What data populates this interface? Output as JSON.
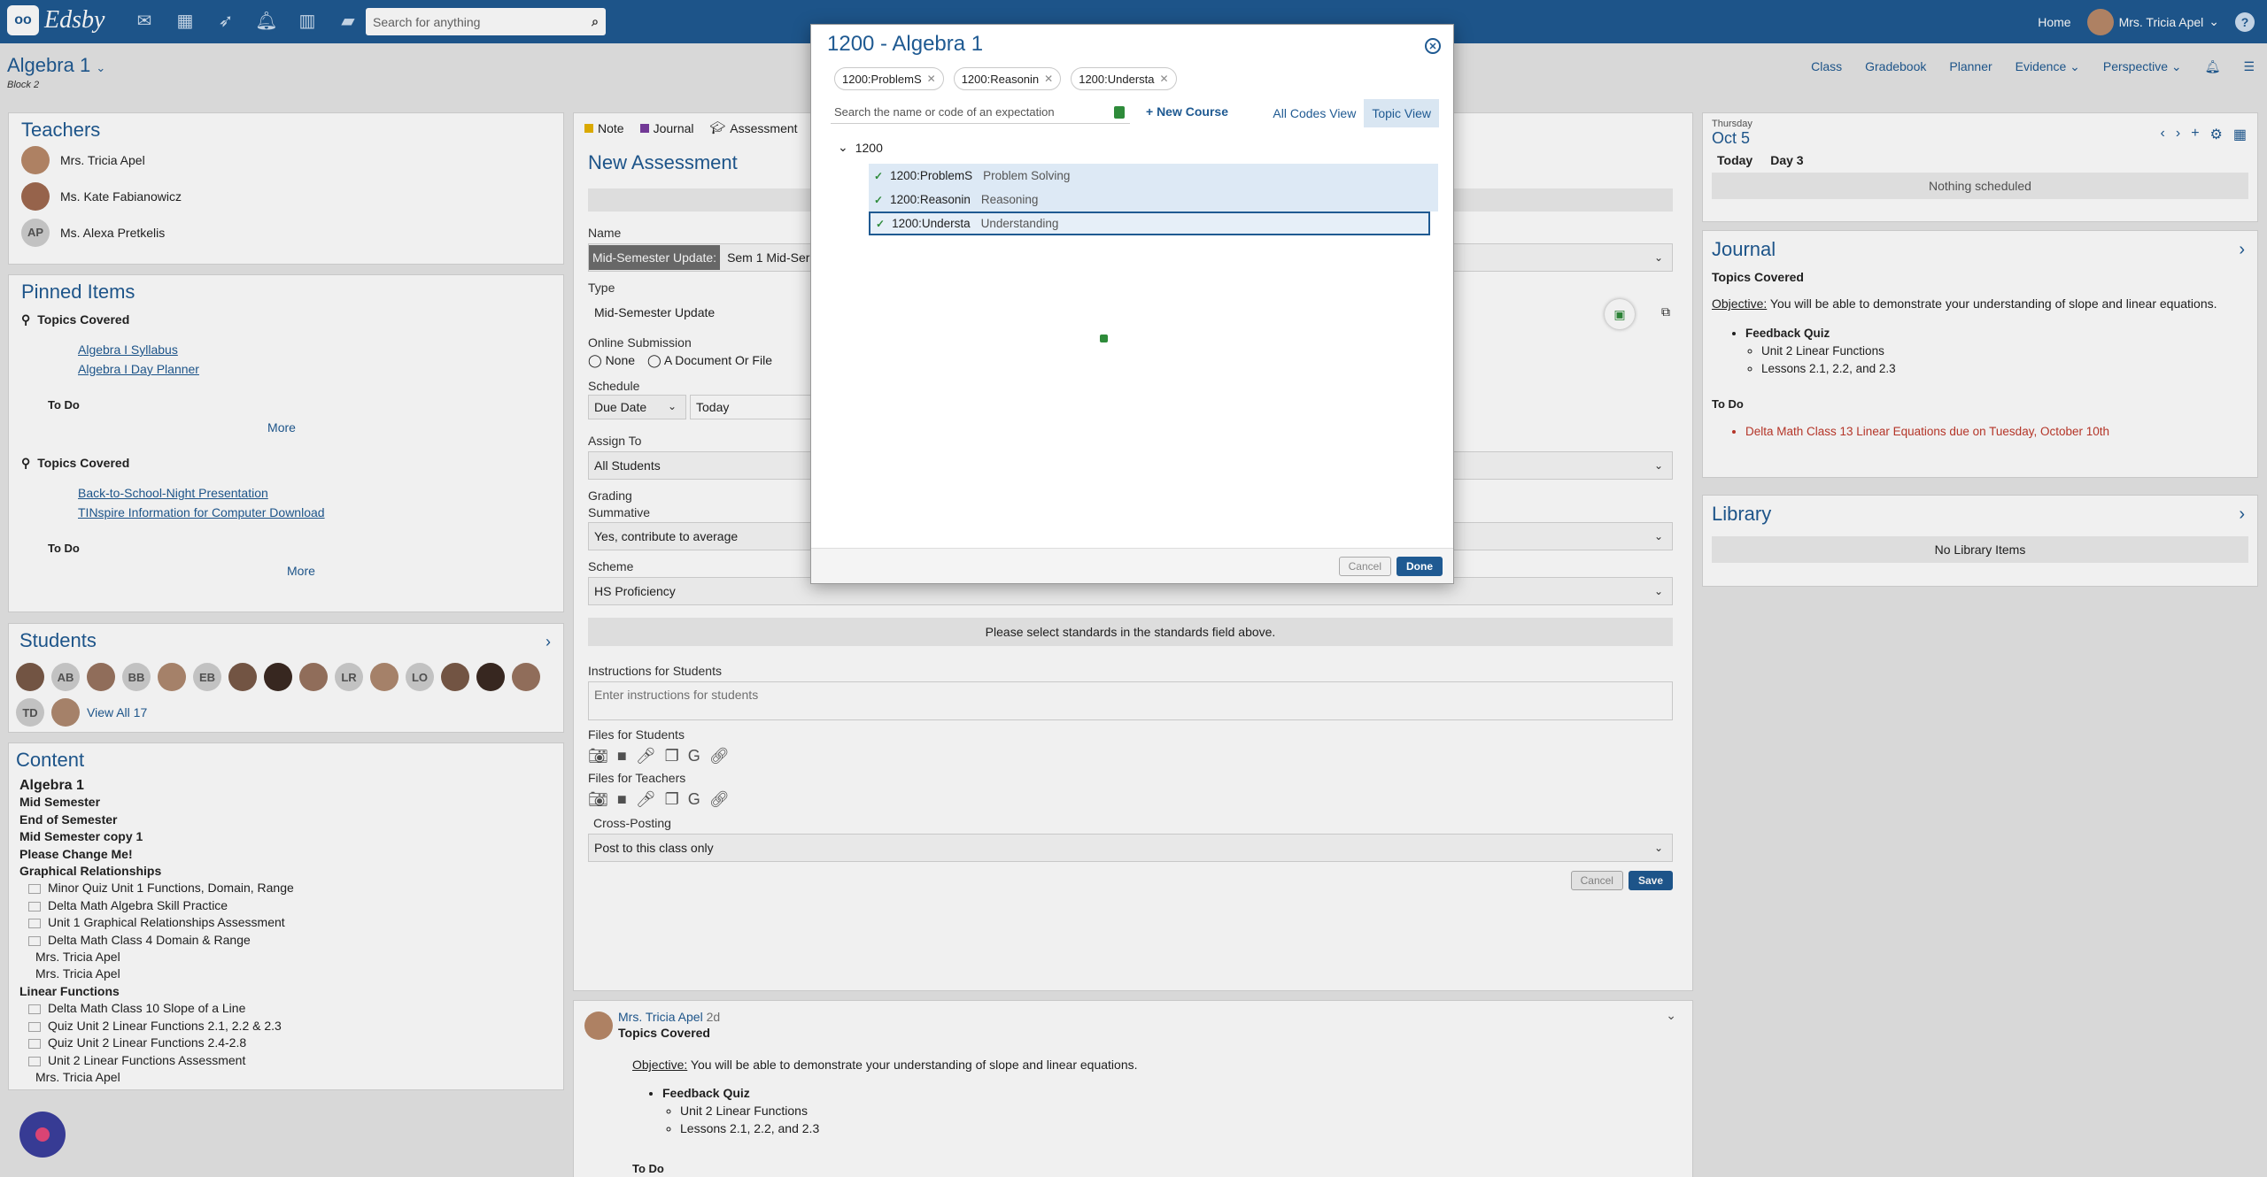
{
  "topbar": {
    "logo_text": "Edsby",
    "search_placeholder": "Search for anything",
    "home_label": "Home",
    "user_name": "Mrs. Tricia Apel",
    "help": "?"
  },
  "class": {
    "title": "Algebra 1",
    "subtitle": "Block 2",
    "nav": [
      "Class",
      "Gradebook",
      "Planner",
      "Evidence",
      "Perspective"
    ]
  },
  "teachers": {
    "heading": "Teachers",
    "items": [
      {
        "name": "Mrs. Tricia Apel",
        "initials": ""
      },
      {
        "name": "Ms. Kate Fabianowicz",
        "initials": ""
      },
      {
        "name": "Ms. Alexa Pretkelis",
        "initials": "AP"
      }
    ]
  },
  "pinned": {
    "heading": "Pinned Items",
    "groups": [
      {
        "title": "Topics Covered",
        "links": [
          "Algebra I Syllabus",
          "Algebra I Day Planner"
        ],
        "todo": "To Do",
        "more": "More"
      },
      {
        "title": "Topics Covered",
        "links": [
          "Back-to-School-Night Presentation",
          "TINspire Information for Computer Download"
        ],
        "todo": "To Do",
        "more": "More"
      }
    ]
  },
  "students": {
    "heading": "Students",
    "initials": [
      "",
      "AB",
      "",
      "BB",
      "",
      "EB",
      "",
      "",
      "",
      "LR",
      "",
      "LO",
      "",
      "",
      "",
      "TD",
      ""
    ],
    "view_all": "View All 17"
  },
  "content": {
    "heading": "Content",
    "items": [
      {
        "text": "Algebra 1",
        "style": "h"
      },
      {
        "text": "Mid Semester",
        "style": "b"
      },
      {
        "text": "End of Semester",
        "style": "b"
      },
      {
        "text": "Mid Semester copy 1",
        "style": "b"
      },
      {
        "text": "Please Change Me!",
        "style": "b"
      },
      {
        "text": "Graphical Relationships",
        "style": "b"
      },
      {
        "text": "Minor Quiz Unit 1 Functions, Domain, Range",
        "style": "i"
      },
      {
        "text": "Delta Math Algebra Skill Practice",
        "style": "i"
      },
      {
        "text": "Unit 1 Graphical Relationships Assessment",
        "style": "i"
      },
      {
        "text": "Delta Math Class 4 Domain & Range",
        "style": "i"
      },
      {
        "text": "Mrs. Tricia Apel",
        "style": "p"
      },
      {
        "text": "Mrs. Tricia Apel",
        "style": "p"
      },
      {
        "text": "Linear Functions",
        "style": "b"
      },
      {
        "text": "Delta Math Class 10 Slope of a Line",
        "style": "i"
      },
      {
        "text": "Quiz Unit 2 Linear Functions 2.1, 2.2 & 2.3",
        "style": "i"
      },
      {
        "text": "Quiz Unit 2 Linear Functions 2.4-2.8",
        "style": "i"
      },
      {
        "text": "Unit 2 Linear Functions Assessment",
        "style": "i"
      },
      {
        "text": "Mrs. Tricia Apel",
        "style": "p"
      }
    ]
  },
  "composer": {
    "tabs": [
      {
        "label": "Note",
        "color": "#e8b400"
      },
      {
        "label": "Journal",
        "color": "#7a3da0"
      },
      {
        "label": "Assessment",
        "color": "#1f5a92"
      }
    ],
    "form_title": "New Assessment",
    "name_label": "Name",
    "name_value_highlight": "Mid-Semester Update:",
    "name_value": "Sem 1 Mid-Ser",
    "type_label": "Type",
    "type_value": "Mid-Semester Update",
    "online_label": "Online Submission",
    "online_options": [
      "None",
      "A Document Or File"
    ],
    "schedule_label": "Schedule",
    "schedule_due": "Due Date",
    "schedule_day": "Today",
    "assign_label": "Assign To",
    "assign_value": "All Students",
    "grading_label": "Grading",
    "summative_label": "Summative",
    "summative_value": "Yes, contribute to average",
    "scheme_label": "Scheme",
    "scheme_value": "HS Proficiency",
    "standards_notice": "Please select standards in the standards field above.",
    "instructions_label": "Instructions for Students",
    "instructions_placeholder": "Enter instructions for students",
    "files_students": "Files for Students",
    "files_teachers": "Files for Teachers",
    "crosspost_label": "Cross-Posting",
    "crosspost_value": "Post to this class only",
    "cancel": "Cancel",
    "save": "Save"
  },
  "post": {
    "author": "Mrs. Tricia Apel",
    "age": "2d",
    "title": "Topics Covered",
    "objective_label": "Objective:",
    "objective_text": "You will be able to demonstrate your understanding of slope and linear equations.",
    "quiz": "Feedback Quiz",
    "sub1": "Unit 2 Linear Functions",
    "sub2": "Lessons 2.1, 2.2, and 2.3",
    "todo": "To Do"
  },
  "calendar": {
    "weekday": "Thursday",
    "date": "Oct 5",
    "today": "Today",
    "day": "Day 3",
    "empty": "Nothing scheduled"
  },
  "journal": {
    "heading": "Journal",
    "title": "Topics Covered",
    "objective_label": "Objective:",
    "objective_text": "You will be able to demonstrate your understanding of slope and linear equations.",
    "quiz": "Feedback Quiz",
    "sub1": "Unit 2 Linear Functions",
    "sub2": "Lessons 2.1, 2.2, and 2.3",
    "todo": "To Do",
    "todo_item": "Delta Math Class 13 Linear Equations due on Tuesday, October 10th"
  },
  "library": {
    "heading": "Library",
    "empty": "No Library Items"
  },
  "modal": {
    "title": "1200 - Algebra 1",
    "chips": [
      "1200:ProblemS",
      "1200:Reasonin",
      "1200:Understa"
    ],
    "search_placeholder": "Search the name or code of an expectation",
    "new_course": "+ New Course",
    "view_tabs": [
      "All Codes View",
      "Topic View"
    ],
    "tree_root": "1200",
    "rows": [
      {
        "code": "1200:ProblemS",
        "desc": "Problem Solving"
      },
      {
        "code": "1200:Reasonin",
        "desc": "Reasoning"
      },
      {
        "code": "1200:Understa",
        "desc": "Understanding"
      }
    ],
    "cancel": "Cancel",
    "done": "Done"
  }
}
